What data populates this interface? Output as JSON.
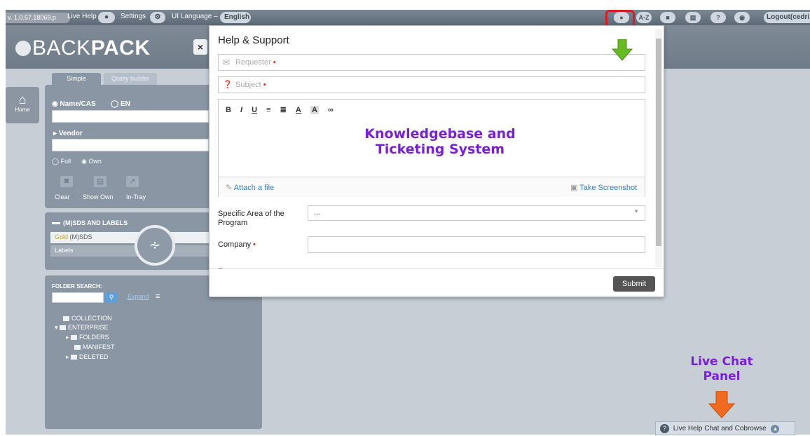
{
  "topbar": {
    "version": "v. 1.0.57.18069.p",
    "live_help": "Live Help",
    "settings": "Settings",
    "ui_language_label": "UI Language –",
    "ui_language_value": "English",
    "az": "A-Z",
    "help": "?",
    "logout": "Logout(cedri"
  },
  "logo": {
    "light": "BACK",
    "bold": "PACK"
  },
  "left_panel": {
    "home_label": "Home",
    "tabs": [
      "Simple",
      "Query builder"
    ],
    "name_cas_label": "Name/CAS",
    "lang_label": "EN",
    "vendor_label": "Vendor",
    "full_label": "Full",
    "own_label": "Own",
    "tools": [
      "Clear",
      "Show Own",
      "In-Tray"
    ],
    "msds_title": "(M)SDS AND LABELS",
    "gold_label": "Gold",
    "msds_label": "(M)SDS",
    "labels_label": "Labels",
    "folder_search_title": "FOLDER SEARCH:",
    "expand_label": "Expand",
    "tree": [
      "COLLECTION",
      "ENTERPRISE",
      "FOLDERS",
      "MANIFEST",
      "DELETED"
    ]
  },
  "modal": {
    "title": "Help & Support",
    "requester_placeholder": "Requester",
    "subject_placeholder": "Subject",
    "toolbar": [
      "B",
      "I",
      "U",
      "≡",
      "≣",
      "A",
      "A",
      "∞"
    ],
    "attach_label": "Attach a file",
    "screenshot_label": "Take Screenshot",
    "area_label": "Specific Area of the Program",
    "area_value": "...",
    "company_label": "Company",
    "next_label": "Ema",
    "submit_label": "Submit"
  },
  "annotations": {
    "kb_line1": "Knowledgebase and",
    "kb_line2": "Ticketing System",
    "chat_line1": "Live Chat",
    "chat_line2": "Panel"
  },
  "livebar": {
    "label": "Live Help Chat and Cobrowse"
  },
  "colors": {
    "accent_red": "#d42020",
    "annotation_purple": "#7a1fd8",
    "arrow_green": "#66bb22",
    "arrow_orange": "#f06a20"
  }
}
